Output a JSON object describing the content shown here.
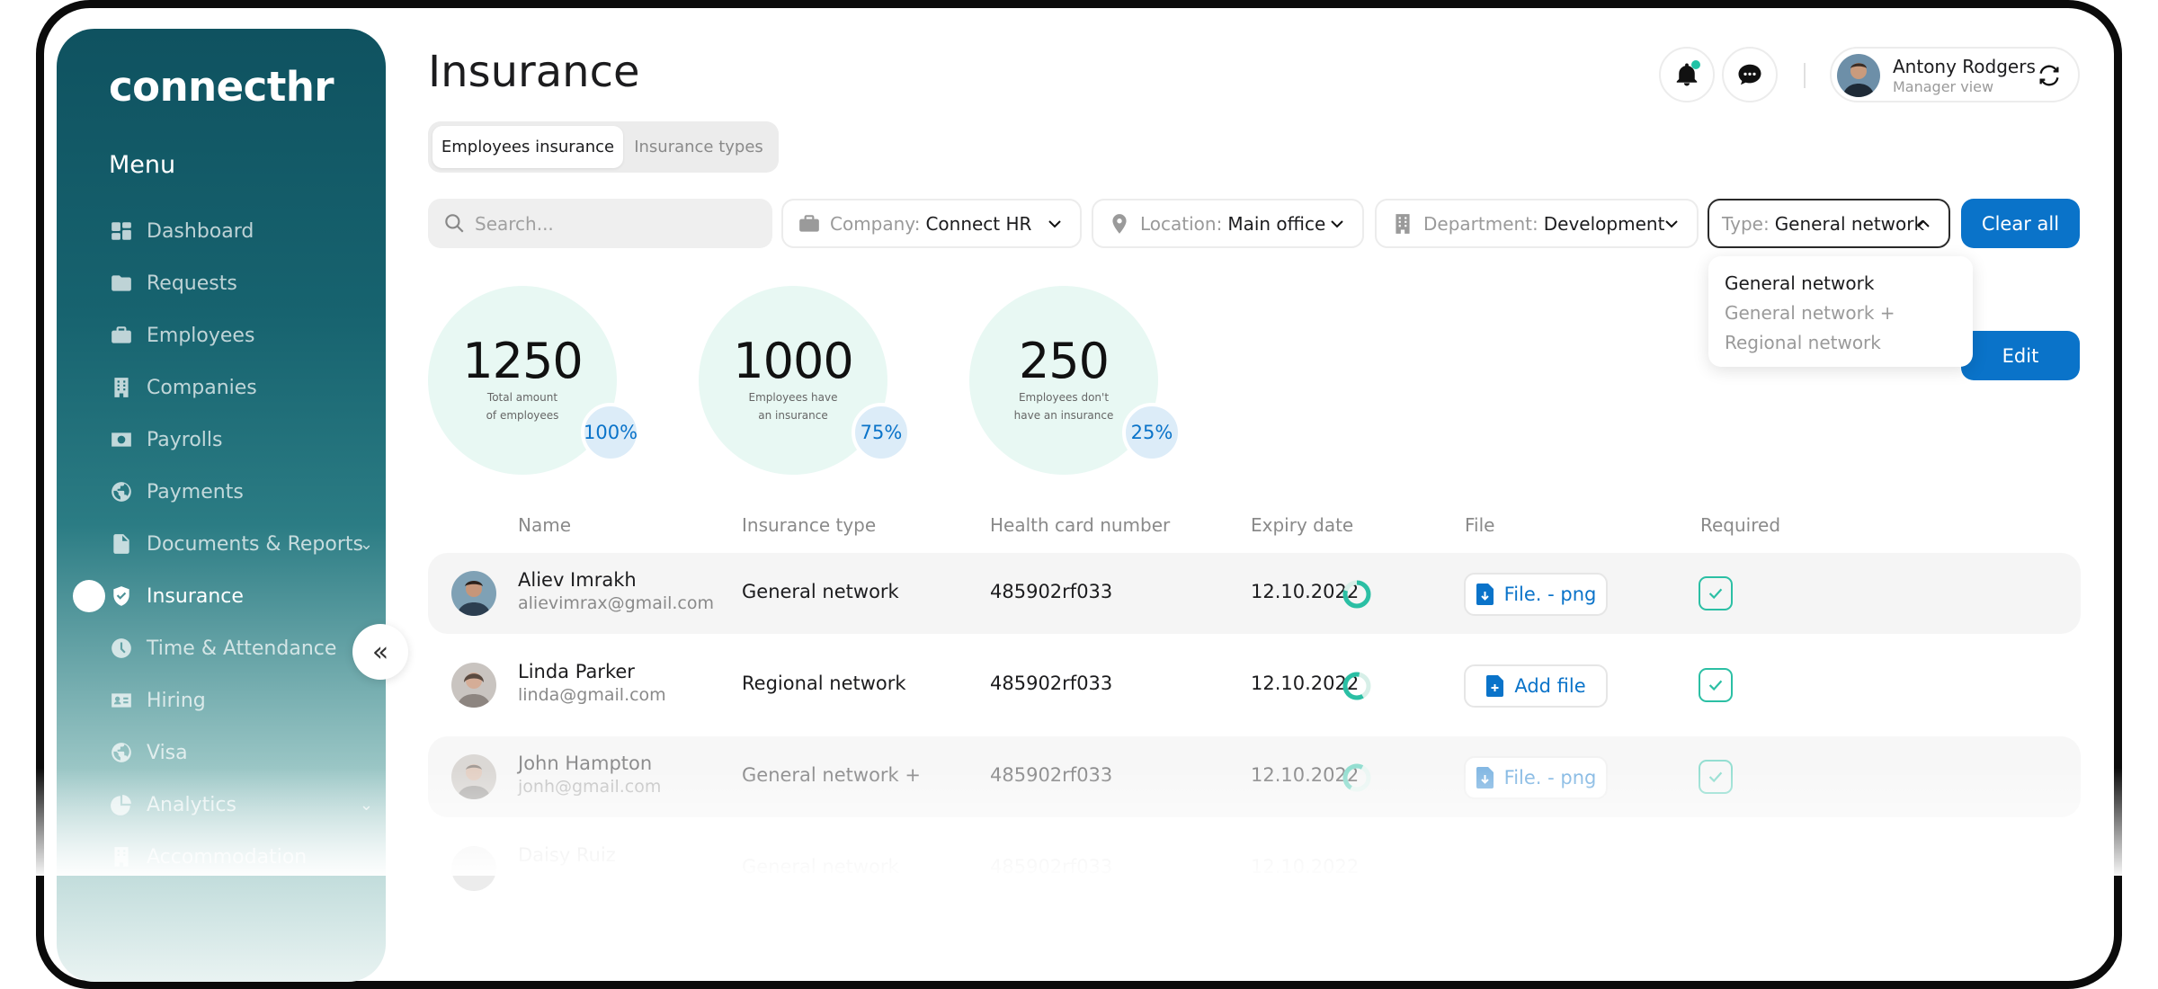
{
  "app": {
    "logo": "connecthr"
  },
  "sidebar": {
    "menu_title": "Menu",
    "items": [
      {
        "label": "Dashboard",
        "icon": "dashboard-icon"
      },
      {
        "label": "Requests",
        "icon": "folder-icon"
      },
      {
        "label": "Employees",
        "icon": "briefcase-icon"
      },
      {
        "label": "Companies",
        "icon": "building-icon"
      },
      {
        "label": "Payrolls",
        "icon": "money-icon"
      },
      {
        "label": "Payments",
        "icon": "globe-icon"
      },
      {
        "label": "Documents & Reports",
        "icon": "document-icon"
      },
      {
        "label": "Insurance",
        "icon": "shield-icon",
        "active": true
      },
      {
        "label": "Time & Attendance",
        "icon": "clock-icon"
      },
      {
        "label": "Hiring",
        "icon": "id-card-icon"
      },
      {
        "label": "Visa",
        "icon": "globe-icon"
      },
      {
        "label": "Analytics",
        "icon": "pie-chart-icon"
      },
      {
        "label": "Accommodation",
        "icon": "building-icon"
      }
    ]
  },
  "header": {
    "title": "Insurance",
    "tabs": [
      {
        "label": "Employees insurance",
        "active": true
      },
      {
        "label": "Insurance types",
        "active": false
      }
    ],
    "user": {
      "name": "Antony Rodgers",
      "role": "Manager view"
    }
  },
  "filters": {
    "search_placeholder": "Search...",
    "company": {
      "label": "Company:",
      "value": "Connect HR"
    },
    "location": {
      "label": "Location:",
      "value": "Main office"
    },
    "department": {
      "label": "Department:",
      "value": "Development"
    },
    "type": {
      "label": "Type:",
      "value": "General network"
    },
    "clear_all": "Clear all",
    "type_options": [
      "General network",
      "General network +",
      "Regional network"
    ]
  },
  "actions": {
    "edit": "Edit"
  },
  "stats": [
    {
      "value": "1250",
      "label_line1": "Total amount",
      "label_line2": "of employees",
      "percent": "100%"
    },
    {
      "value": "1000",
      "label_line1": "Employees have",
      "label_line2": "an insurance",
      "percent": "75%"
    },
    {
      "value": "250",
      "label_line1": "Employees don't",
      "label_line2": "have an insurance",
      "percent": "25%"
    }
  ],
  "table": {
    "columns": [
      "Name",
      "Insurance type",
      "Health card number",
      "Expiry date",
      "File",
      "Required"
    ],
    "rows": [
      {
        "name": "Aliev Imrakh",
        "email": "alievimrax@gmail.com",
        "insurance_type": "General network",
        "health_card": "485902rf033",
        "expiry": "12.10.2022",
        "file": "File. - png",
        "required": true
      },
      {
        "name": "Linda Parker",
        "email": "linda@gmail.com",
        "insurance_type": "Regional network",
        "health_card": "485902rf033",
        "expiry": "12.10.2022",
        "file": "Add file",
        "required": true
      },
      {
        "name": "John Hampton",
        "email": "jonh@gmail.com",
        "insurance_type": "General network +",
        "health_card": "485902rf033",
        "expiry": "12.10.2022",
        "file": "File. - png",
        "required": true
      },
      {
        "name": "Daisy Ruiz",
        "email": "",
        "insurance_type": "General network",
        "health_card": "485902rf033",
        "expiry": "12.10.2022",
        "file": "",
        "required": true
      }
    ]
  },
  "colors": {
    "accent": "#0a73c9",
    "sidebar": "#0f5260",
    "check": "#2bbfa4",
    "stat_bg": "#e8f8f3"
  }
}
